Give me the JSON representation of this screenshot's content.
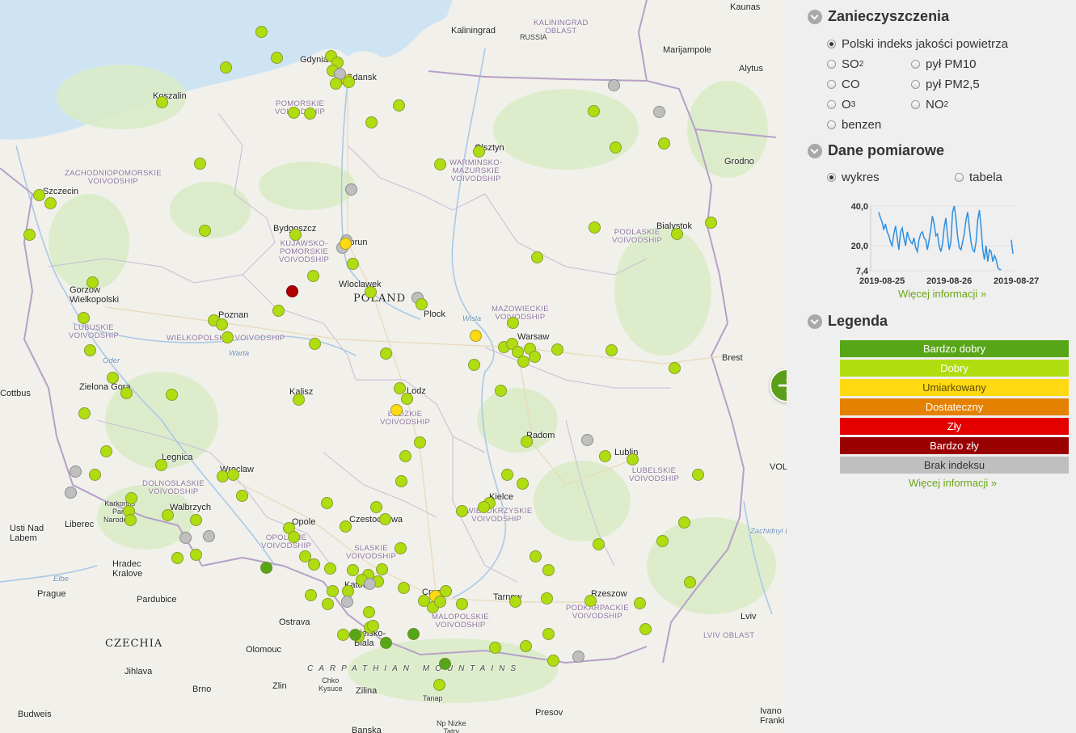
{
  "map": {
    "country_labels": {
      "poland": "POLAND",
      "czechia": "CZECHIA",
      "russia": "RUSSIA"
    },
    "cities": [
      {
        "name": "Kaliningrad",
        "id": "kaliningrad"
      },
      {
        "name": "Gdynia",
        "id": "gdynia"
      },
      {
        "name": "Gdansk",
        "id": "gdansk"
      },
      {
        "name": "Koszalin",
        "id": "koszalin"
      },
      {
        "name": "Szczecin",
        "id": "szczecin"
      },
      {
        "name": "Olsztyn",
        "id": "olsztyn"
      },
      {
        "name": "Bydgoszcz",
        "id": "bydgoszcz"
      },
      {
        "name": "Torun",
        "id": "torun"
      },
      {
        "name": "Wloclawek",
        "id": "wloclawek"
      },
      {
        "name": "Plock",
        "id": "plock"
      },
      {
        "name": "Warsaw",
        "id": "warsaw"
      },
      {
        "name": "Bialystok",
        "id": "bialystok"
      },
      {
        "name": "Grodno",
        "id": "grodno"
      },
      {
        "name": "Marijampole",
        "id": "marijampole"
      },
      {
        "name": "Alytus",
        "id": "alytus"
      },
      {
        "name": "Kaunas",
        "id": "kaunas"
      },
      {
        "name": "Gorzow\nWielkopolski",
        "id": "gorzow"
      },
      {
        "name": "Poznan",
        "id": "poznan"
      },
      {
        "name": "Kalisz",
        "id": "kalisz"
      },
      {
        "name": "Lodz",
        "id": "lodz"
      },
      {
        "name": "Zielona Gora",
        "id": "zielona"
      },
      {
        "name": "Cottbus",
        "id": "cottbus"
      },
      {
        "name": "Legnica",
        "id": "legnica"
      },
      {
        "name": "Wroclaw",
        "id": "wroclaw"
      },
      {
        "name": "Walbrzych",
        "id": "walbrzych"
      },
      {
        "name": "Opole",
        "id": "opole"
      },
      {
        "name": "Czestochowa",
        "id": "czestochowa"
      },
      {
        "name": "Radom",
        "id": "radom"
      },
      {
        "name": "Lublin",
        "id": "lublin"
      },
      {
        "name": "Kielce",
        "id": "kielce"
      },
      {
        "name": "Brest",
        "id": "brest"
      },
      {
        "name": "Katowice",
        "id": "katowice"
      },
      {
        "name": "Cracow",
        "id": "cracow"
      },
      {
        "name": "Tarnow",
        "id": "tarnow"
      },
      {
        "name": "Rzeszow",
        "id": "rzeszow"
      },
      {
        "name": "Lviv",
        "id": "lviv"
      },
      {
        "name": "Liberec",
        "id": "liberec"
      },
      {
        "name": "Usti Nad\nLabem",
        "id": "usti"
      },
      {
        "name": "Hradec\nKralove",
        "id": "hradec"
      },
      {
        "name": "Prague",
        "id": "prague"
      },
      {
        "name": "Pardubice",
        "id": "pardubice"
      },
      {
        "name": "Ostrava",
        "id": "ostrava"
      },
      {
        "name": "Olomouc",
        "id": "olomouc"
      },
      {
        "name": "Jihlava",
        "id": "jihlava"
      },
      {
        "name": "Brno",
        "id": "brno"
      },
      {
        "name": "Zlin",
        "id": "zlin"
      },
      {
        "name": "Zilina",
        "id": "zilina"
      },
      {
        "name": "Presov",
        "id": "presov"
      },
      {
        "name": "Budweis",
        "id": "budweis"
      },
      {
        "name": "Bielsko-\nBiala",
        "id": "bielsko"
      },
      {
        "name": "Ivano\nFranki",
        "id": "ivano"
      },
      {
        "name": "Chko\nKysuce",
        "id": "kysuce"
      },
      {
        "name": "Tanap",
        "id": "tanap"
      },
      {
        "name": "Np Nizke\nTatry",
        "id": "nizke"
      },
      {
        "name": "Karkonos\nPark\nNarodowy",
        "id": "karkonos"
      },
      {
        "name": "Banska",
        "id": "banska"
      },
      {
        "name": "VOL",
        "id": "vol"
      }
    ],
    "regions": [
      {
        "name": "KALININGRAD\nOBLAST",
        "id": "kal-oblast"
      },
      {
        "name": "POMORSKIE\nVOIVODSHIP",
        "id": "pomorskie"
      },
      {
        "name": "ZACHODNIOPOMORSKIE\nVOIVODSHIP",
        "id": "zachodnio"
      },
      {
        "name": "WARMINSKO-\nMAZURSKIE\nVOIVODSHIP",
        "id": "warminsko"
      },
      {
        "name": "KUJAWSKO-\nPOMORSKIE\nVOIVODSHIP",
        "id": "kujawsko"
      },
      {
        "name": "PODLASKIE\nVOIVODSHIP",
        "id": "podlaskie"
      },
      {
        "name": "MAZOWIECKIE\nVOIVODSHIP",
        "id": "mazowieckie"
      },
      {
        "name": "LUBUSKIE\nVOIVODSHIP",
        "id": "lubuskie"
      },
      {
        "name": "WIELKOPOLSKIE VOIVODSHIP",
        "id": "wielkopolskie"
      },
      {
        "name": "ŁÓDZKIE\nVOIVODSHIP",
        "id": "lodzkie"
      },
      {
        "name": "DOLNOSLASKIE\nVOIVODSHIP",
        "id": "dolnoslaskie"
      },
      {
        "name": "LUBELSKIE\nVOIVODSHIP",
        "id": "lubelskie"
      },
      {
        "name": "SWIETOKRZYSKIE\nVOIVODSHIP",
        "id": "swietokrzyskie"
      },
      {
        "name": "OPOLSKIE\nVOIVODSHIP",
        "id": "opolskie"
      },
      {
        "name": "SLASKIE\nVOIVODSHIP",
        "id": "slaskie"
      },
      {
        "name": "MALOPOLSKIE\nVOIVODSHIP",
        "id": "malopolskie"
      },
      {
        "name": "PODKARPACKIE\nVOIVODSHIP",
        "id": "podkarpackie"
      },
      {
        "name": "LVIV OBLAST",
        "id": "lviv-oblast"
      }
    ],
    "rivers": [
      "Wisla",
      "Warta",
      "Oder",
      "Elbe",
      "Zachidnyi Buh"
    ],
    "mountains": "CARPATHIAN MOUNTAINS"
  },
  "panel": {
    "pollution_title": "Zanieczyszczenia",
    "pollutants": [
      {
        "label": "Polski indeks jakości powietrza",
        "selected": true
      },
      {
        "label": "SO",
        "sub": "2",
        "selected": false
      },
      {
        "label": "pył PM10",
        "selected": false
      },
      {
        "label": "CO",
        "selected": false
      },
      {
        "label": "pył PM2,5",
        "selected": false
      },
      {
        "label": "O",
        "sub": "3",
        "selected": false
      },
      {
        "label": "NO",
        "sub": "2",
        "selected": false
      },
      {
        "label": "benzen",
        "selected": false
      }
    ],
    "measurement_title": "Dane pomiarowe",
    "view_options": [
      {
        "label": "wykres",
        "selected": true
      },
      {
        "label": "tabela",
        "selected": false
      }
    ],
    "more_info": "Więcej informacji »",
    "legend_title": "Legenda",
    "legend": [
      {
        "label": "Bardzo dobry",
        "bg": "#57a618",
        "fg": "#ffffff"
      },
      {
        "label": "Dobry",
        "bg": "#b0dd10",
        "fg": "#ffffff"
      },
      {
        "label": "Umiarkowany",
        "bg": "#ffd911",
        "fg": "#5b4a00"
      },
      {
        "label": "Dostateczny",
        "bg": "#e58100",
        "fg": "#ffffff"
      },
      {
        "label": "Zły",
        "bg": "#e50000",
        "fg": "#ffffff"
      },
      {
        "label": "Bardzo zły",
        "bg": "#990000",
        "fg": "#ffffff"
      },
      {
        "label": "Brak indeksu",
        "bg": "#bfbfbf",
        "fg": "#333333"
      }
    ]
  },
  "chart_data": {
    "type": "line",
    "x_tick_labels": [
      "2019-08-25",
      "2019-08-26",
      "2019-08-27"
    ],
    "y_tick_labels": [
      "40,0",
      "20,0",
      "7,4"
    ],
    "ylim": [
      7.4,
      40.0
    ],
    "series": [
      {
        "color": "#2e8fe0",
        "segments": [
          [
            37,
            34,
            32,
            28,
            31,
            27,
            25,
            22,
            20,
            26,
            30,
            24,
            18,
            27,
            29,
            24,
            20,
            27,
            24,
            22,
            21,
            24,
            19,
            17,
            23,
            26,
            27,
            24,
            23,
            18,
            23,
            28,
            35,
            31,
            25,
            26,
            20,
            17,
            21,
            29,
            34,
            25,
            18,
            22,
            37,
            40,
            34,
            25,
            19,
            18,
            22,
            26,
            33,
            37,
            29,
            22,
            18,
            17,
            22,
            33,
            38,
            29,
            18,
            13,
            20,
            12,
            18,
            17,
            12,
            15,
            13,
            9,
            8,
            8
          ],
          [
            23,
            16
          ]
        ]
      }
    ]
  },
  "stations": [
    [
      "g",
      324,
      40
    ],
    [
      "g",
      280,
      84
    ],
    [
      "g",
      343,
      72
    ],
    [
      "g",
      410,
      70
    ],
    [
      "g",
      418,
      78
    ],
    [
      "y",
      430,
      100
    ],
    [
      "g",
      412,
      88
    ],
    [
      "x",
      421,
      92
    ],
    [
      "g",
      416,
      104
    ],
    [
      "g",
      432,
      102
    ],
    [
      "g",
      201,
      127
    ],
    [
      "g",
      364,
      140
    ],
    [
      "g",
      384,
      141
    ],
    [
      "g",
      460,
      152
    ],
    [
      "g",
      494,
      131
    ],
    [
      "x",
      760,
      106
    ],
    [
      "g",
      735,
      138
    ],
    [
      "x",
      816,
      139
    ],
    [
      "g",
      762,
      183
    ],
    [
      "g",
      822,
      178
    ],
    [
      "g",
      593,
      188
    ],
    [
      "g",
      545,
      204
    ],
    [
      "g",
      248,
      203
    ],
    [
      "x",
      435,
      235
    ],
    [
      "g",
      49,
      242
    ],
    [
      "g",
      63,
      252
    ],
    [
      "g",
      37,
      291
    ],
    [
      "g",
      254,
      286
    ],
    [
      "g",
      366,
      291
    ],
    [
      "x",
      429,
      298
    ],
    [
      "x",
      424,
      307
    ],
    [
      "y",
      428,
      302
    ],
    [
      "g",
      437,
      327
    ],
    [
      "g",
      388,
      342
    ],
    [
      "g",
      736,
      282
    ],
    [
      "g",
      838,
      290
    ],
    [
      "g",
      880,
      276
    ],
    [
      "g",
      665,
      319
    ],
    [
      "g",
      115,
      350
    ],
    [
      "r",
      362,
      361
    ],
    [
      "g",
      459,
      362
    ],
    [
      "x",
      517,
      369
    ],
    [
      "g",
      522,
      377
    ],
    [
      "g",
      345,
      385
    ],
    [
      "g",
      265,
      397
    ],
    [
      "g",
      275,
      402
    ],
    [
      "g",
      104,
      394
    ],
    [
      "g",
      282,
      418
    ],
    [
      "g",
      390,
      426
    ],
    [
      "y",
      589,
      416
    ],
    [
      "g",
      635,
      400
    ],
    [
      "g",
      624,
      430
    ],
    [
      "g",
      634,
      426
    ],
    [
      "g",
      641,
      436
    ],
    [
      "g",
      656,
      432
    ],
    [
      "g",
      662,
      442
    ],
    [
      "g",
      648,
      448
    ],
    [
      "g",
      690,
      433
    ],
    [
      "g",
      757,
      434
    ],
    [
      "g",
      478,
      438
    ],
    [
      "g",
      587,
      452
    ],
    [
      "g",
      112,
      434
    ],
    [
      "g",
      835,
      456
    ],
    [
      "g",
      140,
      468
    ],
    [
      "g",
      157,
      487
    ],
    [
      "g",
      213,
      489
    ],
    [
      "g",
      370,
      495
    ],
    [
      "g",
      495,
      481
    ],
    [
      "g",
      504,
      494
    ],
    [
      "y",
      491,
      508
    ],
    [
      "g",
      620,
      484
    ],
    [
      "g",
      105,
      512
    ],
    [
      "g",
      520,
      548
    ],
    [
      "g",
      652,
      547
    ],
    [
      "x",
      727,
      545
    ],
    [
      "g",
      502,
      565
    ],
    [
      "g",
      749,
      565
    ],
    [
      "g",
      783,
      569
    ],
    [
      "g",
      132,
      559
    ],
    [
      "g",
      200,
      576
    ],
    [
      "x",
      94,
      584
    ],
    [
      "g",
      118,
      588
    ],
    [
      "g",
      276,
      590
    ],
    [
      "g",
      289,
      588
    ],
    [
      "g",
      628,
      588
    ],
    [
      "g",
      647,
      599
    ],
    [
      "g",
      497,
      596
    ],
    [
      "x",
      88,
      610
    ],
    [
      "g",
      864,
      588
    ],
    [
      "g",
      300,
      614
    ],
    [
      "g",
      163,
      617
    ],
    [
      "g",
      160,
      633
    ],
    [
      "g",
      162,
      644
    ],
    [
      "g",
      208,
      638
    ],
    [
      "g",
      243,
      644
    ],
    [
      "g",
      405,
      623
    ],
    [
      "g",
      466,
      628
    ],
    [
      "g",
      606,
      623
    ],
    [
      "g",
      572,
      633
    ],
    [
      "g",
      599,
      628
    ],
    [
      "g",
      428,
      652
    ],
    [
      "g",
      358,
      654
    ],
    [
      "g",
      477,
      643
    ],
    [
      "x",
      230,
      666
    ],
    [
      "x",
      259,
      664
    ],
    [
      "g",
      364,
      665
    ],
    [
      "g",
      847,
      647
    ],
    [
      "g",
      820,
      670
    ],
    [
      "g",
      741,
      674
    ],
    [
      "g",
      220,
      691
    ],
    [
      "g",
      243,
      687
    ],
    [
      "g",
      378,
      689
    ],
    [
      "g",
      389,
      699
    ],
    [
      "g",
      496,
      679
    ],
    [
      "g",
      663,
      689
    ],
    [
      "b",
      330,
      703
    ],
    [
      "g",
      409,
      704
    ],
    [
      "g",
      437,
      706
    ],
    [
      "g",
      456,
      712
    ],
    [
      "g",
      473,
      705
    ],
    [
      "g",
      468,
      720
    ],
    [
      "g",
      679,
      706
    ],
    [
      "g",
      854,
      721
    ],
    [
      "g",
      385,
      737
    ],
    [
      "g",
      412,
      732
    ],
    [
      "g",
      406,
      748
    ],
    [
      "g",
      431,
      732
    ],
    [
      "x",
      430,
      745
    ],
    [
      "g",
      448,
      718
    ],
    [
      "x",
      458,
      723
    ],
    [
      "g",
      500,
      728
    ],
    [
      "g",
      525,
      744
    ],
    [
      "g",
      536,
      752
    ],
    [
      "y",
      539,
      738
    ],
    [
      "g",
      545,
      745
    ],
    [
      "g",
      552,
      732
    ],
    [
      "g",
      572,
      748
    ],
    [
      "g",
      638,
      745
    ],
    [
      "g",
      677,
      741
    ],
    [
      "g",
      731,
      744
    ],
    [
      "g",
      792,
      747
    ],
    [
      "g",
      457,
      758
    ],
    [
      "g",
      458,
      777
    ],
    [
      "g",
      462,
      775
    ],
    [
      "g",
      425,
      786
    ],
    [
      "g",
      444,
      788
    ],
    [
      "b",
      440,
      786
    ],
    [
      "b",
      478,
      796
    ],
    [
      "b",
      512,
      785
    ],
    [
      "g",
      799,
      779
    ],
    [
      "g",
      613,
      802
    ],
    [
      "g",
      651,
      800
    ],
    [
      "g",
      679,
      785
    ],
    [
      "x",
      716,
      813
    ],
    [
      "g",
      685,
      818
    ],
    [
      "b",
      551,
      822
    ],
    [
      "g",
      544,
      848
    ]
  ]
}
